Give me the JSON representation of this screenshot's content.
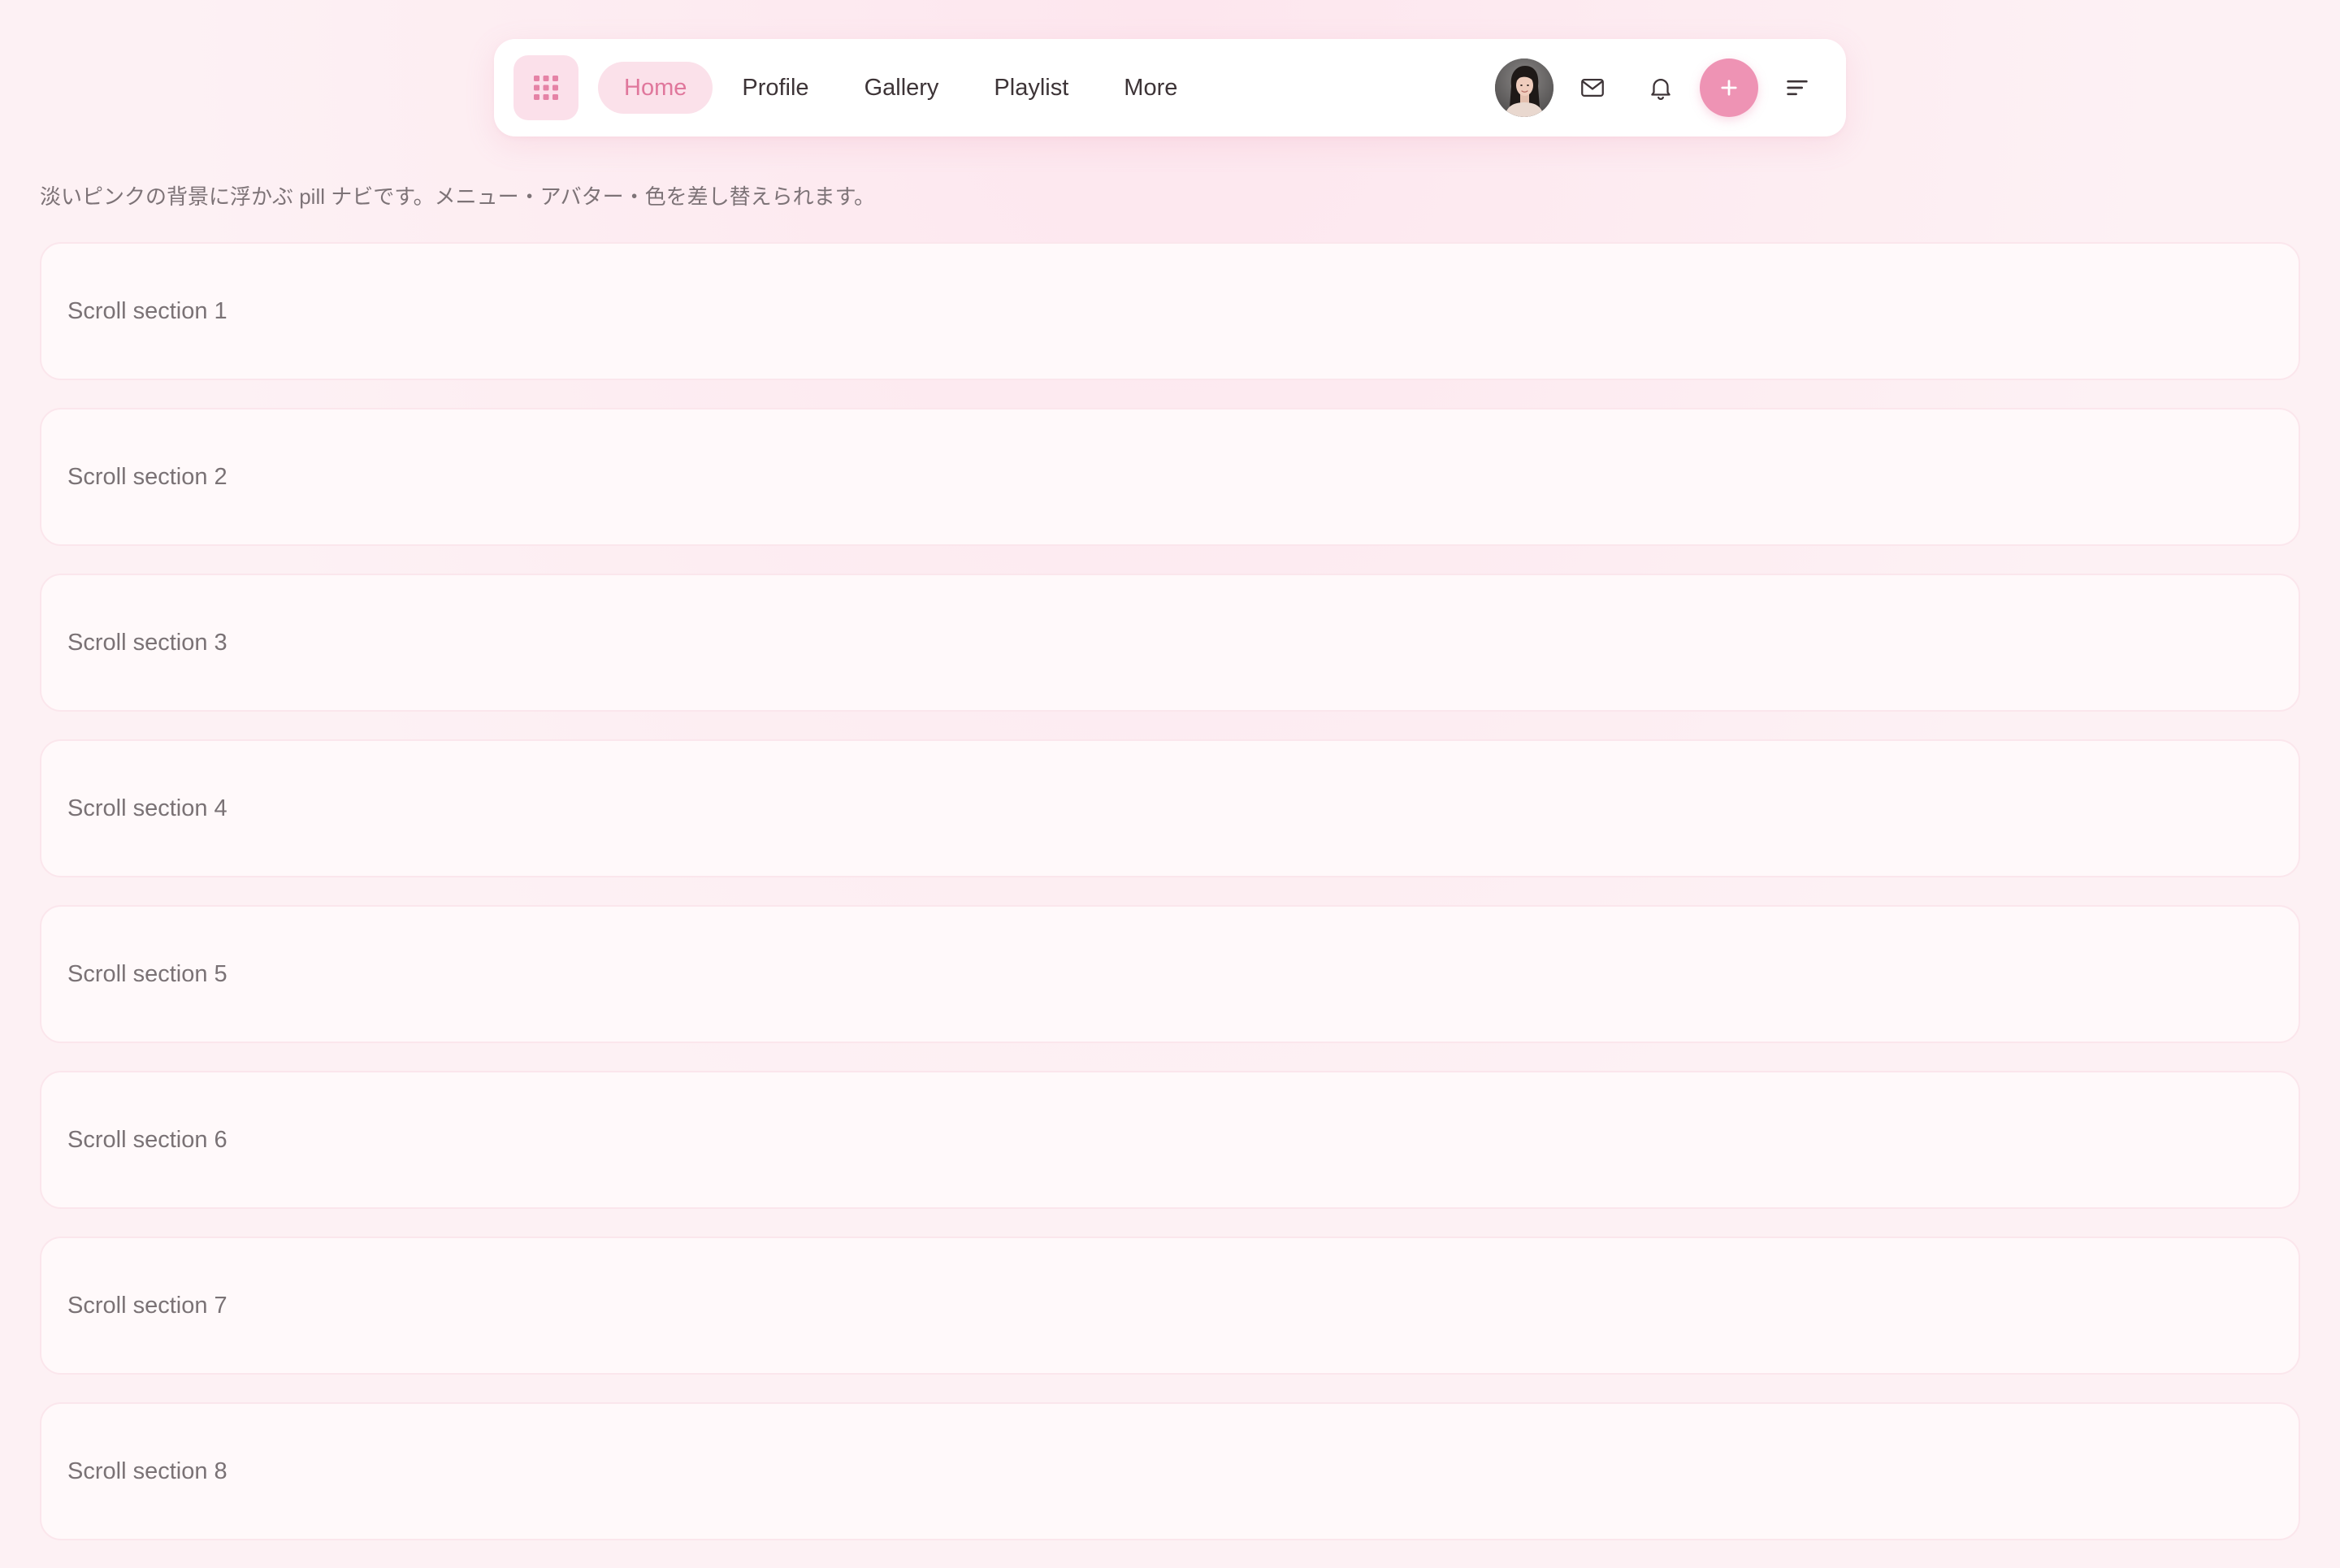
{
  "nav": {
    "apps_icon": "grid-icon",
    "links": [
      {
        "label": "Home",
        "active": true
      },
      {
        "label": "Profile",
        "active": false
      },
      {
        "label": "Gallery",
        "active": false
      },
      {
        "label": "Playlist",
        "active": false
      },
      {
        "label": "More",
        "active": false
      }
    ],
    "avatar_icon": "user-avatar",
    "mail_icon": "mail-icon",
    "bell_icon": "bell-icon",
    "add_label": "+",
    "menu_icon": "menu-lines-icon"
  },
  "intro_text": "淡いピンクの背景に浮かぶ pill ナビです。メニュー・アバター・色を差し替えられます。",
  "sections": [
    {
      "label": "Scroll section 1"
    },
    {
      "label": "Scroll section 2"
    },
    {
      "label": "Scroll section 3"
    },
    {
      "label": "Scroll section 4"
    },
    {
      "label": "Scroll section 5"
    },
    {
      "label": "Scroll section 6"
    },
    {
      "label": "Scroll section 7"
    },
    {
      "label": "Scroll section 8"
    }
  ],
  "colors": {
    "page_background": "#fdf1f4",
    "accent": "#ee93b4",
    "active_tab_background": "#fbe1ea",
    "active_tab_text": "#e0779c"
  }
}
